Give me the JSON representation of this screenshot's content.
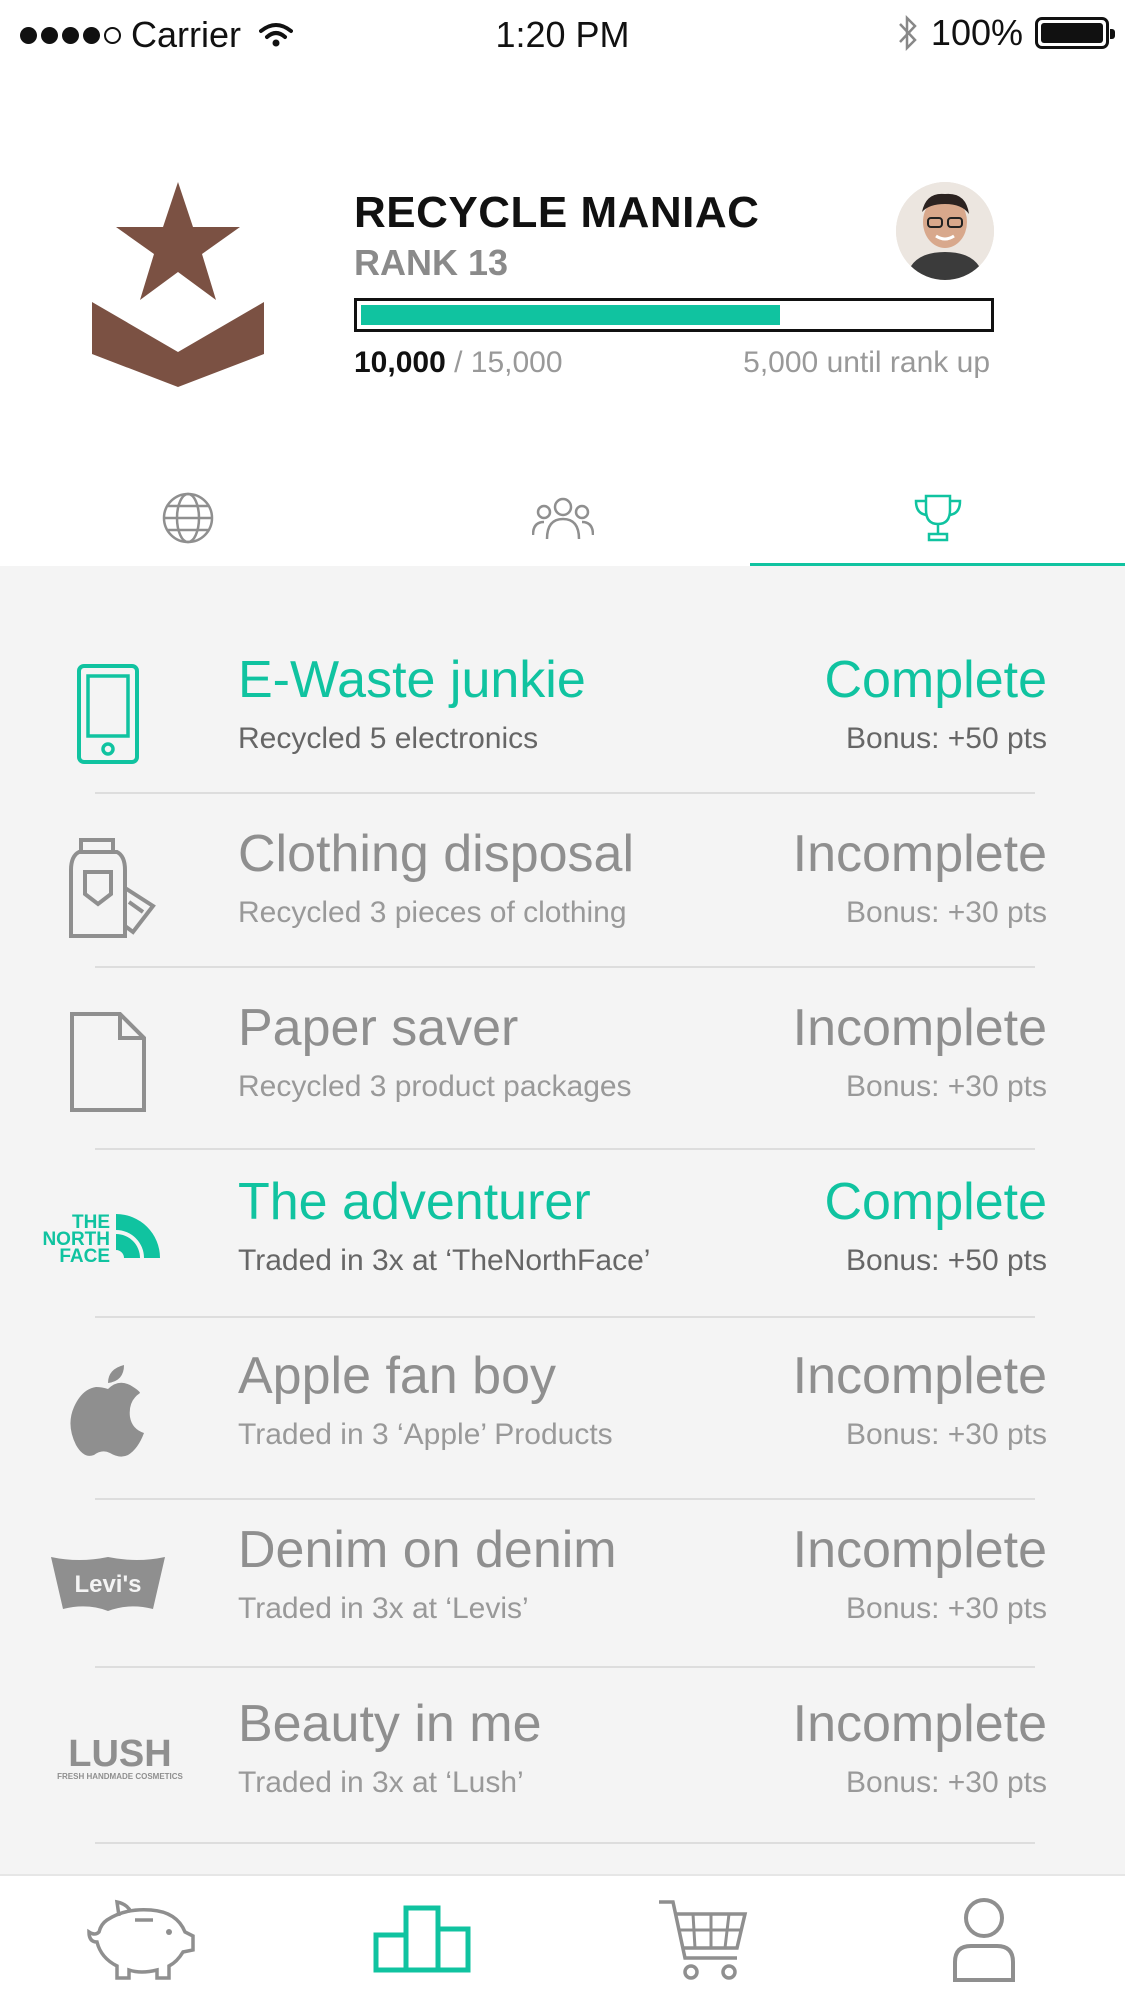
{
  "status_bar": {
    "carrier": "Carrier",
    "time": "1:20 PM",
    "battery": "100%"
  },
  "profile": {
    "title": "RECYCLE MANIAC",
    "rank": "RANK 13",
    "points_current": "10,000",
    "points_total": "/ 15,000",
    "until_rank_up": "5,000 until rank up",
    "progress_fraction": 0.67,
    "accent": "#10c3a0",
    "badge_color": "#7b5143"
  },
  "tabs": [
    {
      "icon": "globe-icon",
      "active": false
    },
    {
      "icon": "friends-icon",
      "active": false
    },
    {
      "icon": "trophy-icon",
      "active": true
    }
  ],
  "achievements": [
    {
      "icon": "phone-icon",
      "title": "E-Waste junkie",
      "subtitle": "Recycled 5 electronics",
      "status": "Complete",
      "bonus": "Bonus: +50 pts",
      "complete": true
    },
    {
      "icon": "clothing-icon",
      "title": "Clothing disposal",
      "subtitle": "Recycled 3 pieces of clothing",
      "status": "Incomplete",
      "bonus": "Bonus: +30 pts",
      "complete": false
    },
    {
      "icon": "paper-icon",
      "title": "Paper saver",
      "subtitle": "Recycled 3 product packages",
      "status": "Incomplete",
      "bonus": "Bonus: +30 pts",
      "complete": false
    },
    {
      "icon": "northface-logo",
      "title": "The adventurer",
      "subtitle": "Traded in 3x  at ‘TheNorthFace’",
      "status": "Complete",
      "bonus": "Bonus: +50 pts",
      "complete": true,
      "logo_text": [
        "THE",
        "NORTH",
        "FACE"
      ]
    },
    {
      "icon": "apple-logo",
      "title": "Apple fan boy",
      "subtitle": "Traded in 3 ‘Apple’ Products",
      "status": "Incomplete",
      "bonus": "Bonus: +30 pts",
      "complete": false
    },
    {
      "icon": "levis-logo",
      "title": "Denim on denim",
      "subtitle": "Traded in 3x at ‘Levis’",
      "status": "Incomplete",
      "bonus": "Bonus: +30 pts",
      "complete": false,
      "logo_text": "Levi's"
    },
    {
      "icon": "lush-logo",
      "title": "Beauty in me",
      "subtitle": "Traded in 3x at ‘Lush’",
      "status": "Incomplete",
      "bonus": "Bonus: +30 pts",
      "complete": false,
      "logo_text": [
        "LUSH",
        "FRESH HANDMADE COSMETICS"
      ]
    }
  ],
  "bottom_nav": [
    {
      "icon": "piggy-bank-icon",
      "active": false
    },
    {
      "icon": "leaderboard-icon",
      "active": true
    },
    {
      "icon": "cart-icon",
      "active": false
    },
    {
      "icon": "user-icon",
      "active": false
    }
  ]
}
